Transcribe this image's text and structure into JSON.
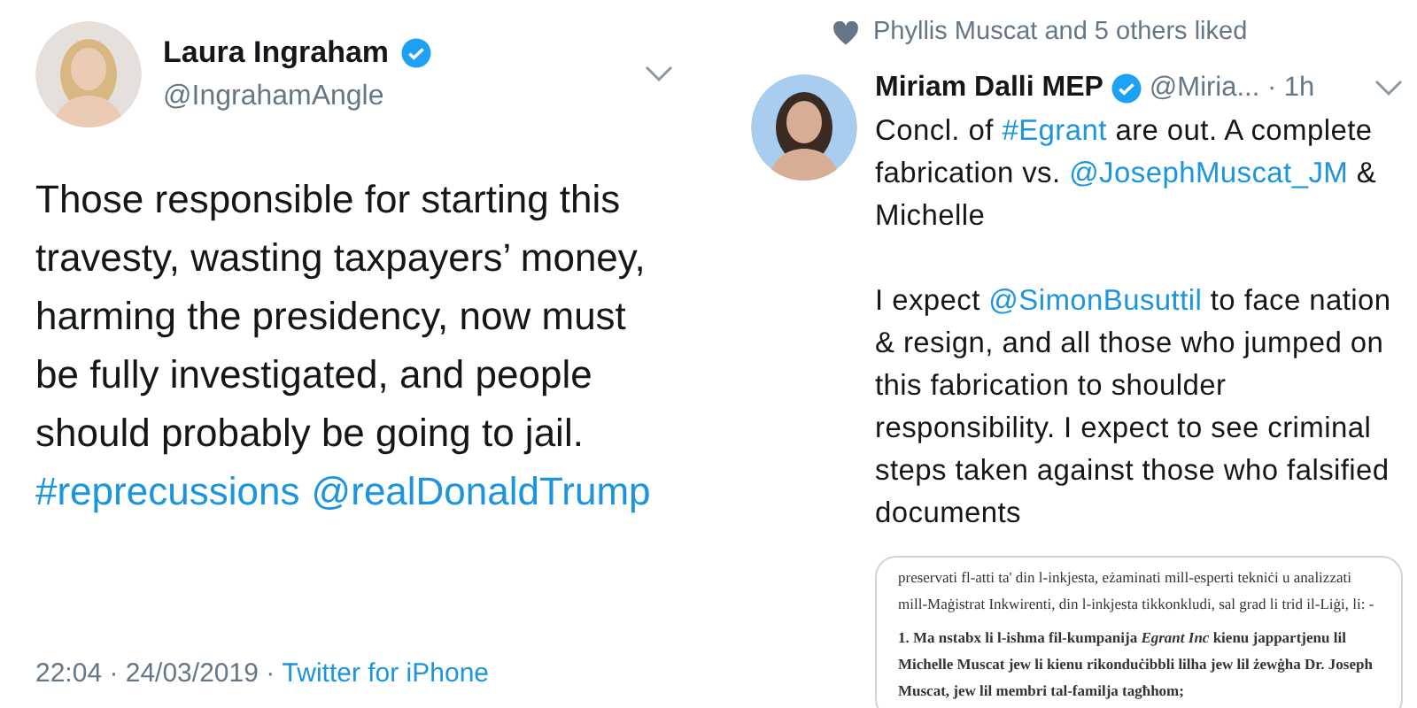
{
  "left_tweet": {
    "name": "Laura Ingraham",
    "verified": true,
    "handle": "@IngrahamAngle",
    "body": [
      {
        "kind": "plain",
        "text": "Those responsible for starting this travesty, wasting taxpayers’ money, harming the presidency, now must be fully investigated, and people should probably be going to jail. "
      },
      {
        "kind": "link",
        "text": "#reprecussions"
      },
      {
        "kind": "link",
        "text": "@realDonaldTrump"
      }
    ],
    "time": "22:04 · 24/03/2019 · ",
    "source": "Twitter for iPhone"
  },
  "right_tweet": {
    "liked_by": "Phyllis Muscat and 5 others liked",
    "name": "Miriam Dalli MEP",
    "verified": true,
    "handle": "@Miria... · 1h",
    "paragraphs": [
      [
        {
          "kind": "plain",
          "text": "Concl. of "
        },
        {
          "kind": "link",
          "text": "#Egrant"
        },
        {
          "kind": "plain",
          "text": " are out. A complete fabrication vs. "
        },
        {
          "kind": "link",
          "text": "@JosephMuscat_JM"
        },
        {
          "kind": "plain",
          "text": " & Michelle"
        }
      ],
      [
        {
          "kind": "plain",
          "text": "I expect "
        },
        {
          "kind": "link",
          "text": "@SimonBusuttil"
        },
        {
          "kind": "plain",
          "text": " to face nation & resign, and all those who jumped on this fabrication to shoulder responsibility. I expect to see criminal steps taken against those who falsified documents"
        }
      ]
    ],
    "document": [
      {
        "kind": "plain",
        "text": "preservati fl-atti ta' din l-inkjesta, eżaminati mill-esperti tekniċi u analizzati mill-Maġistrat Inkwirenti, din l-inkjesta tikkonkludi, sal grad li trid il-Liġi, li: -"
      },
      {
        "kind": "bold",
        "text": "1. Ma nstabx li l-ishma fil-kumpanija *Egrant Inc* kienu jappartjenu lil Michelle Muscat jew li kienu rikonduċibbli lilha jew lil żewġha Dr. Joseph Muscat, jew lil membri tal-familja tagħhom;"
      }
    ]
  }
}
